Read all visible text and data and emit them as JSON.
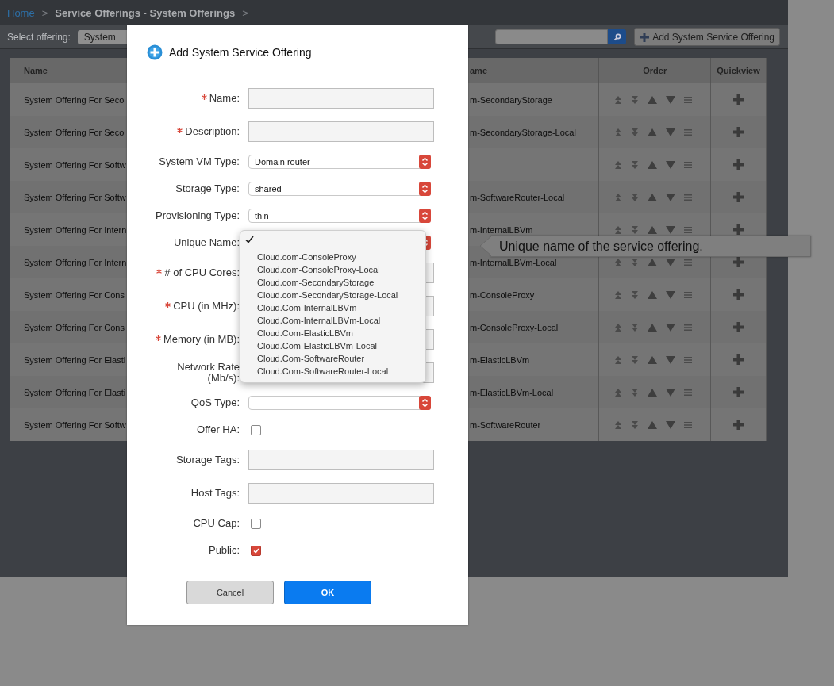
{
  "breadcrumb": {
    "items": [
      {
        "label": "Home",
        "kind": "link"
      },
      {
        "label": ">",
        "kind": "separator"
      },
      {
        "label": "Service Offerings - System Offerings",
        "kind": "current"
      },
      {
        "label": ">",
        "kind": "separator"
      }
    ]
  },
  "toolbar": {
    "filter_label": "Select offering:",
    "filter_value": "System",
    "add_button": "Add System Service Offering"
  },
  "table": {
    "columns": [
      "Name",
      "ame",
      "Order",
      "Quickview"
    ],
    "rows": [
      {
        "name": "System Offering For Seco",
        "column_3": "m-SecondaryStorage"
      },
      {
        "name": "System Offering For Seco",
        "column_3": "m-SecondaryStorage-Local"
      },
      {
        "name": "System Offering For Softw"
      },
      {
        "name": "System Offering For Softw",
        "column_3": "m-SoftwareRouter-Local"
      },
      {
        "name": "System Offering For Intern",
        "column_3": "m-InternalLBVm"
      },
      {
        "name": "System Offering For Intern",
        "column_3": "m-InternalLBVm-Local"
      },
      {
        "name": "System Offering For Cons",
        "column_3": "m-ConsoleProxy"
      },
      {
        "name": "System Offering For Cons",
        "column_3": "m-ConsoleProxy-Local"
      },
      {
        "name": "System Offering For Elasti",
        "column_3": "m-ElasticLBVm"
      },
      {
        "name": "System Offering For Elasti",
        "column_3": "m-ElasticLBVm-Local"
      },
      {
        "name": "System Offering For Softw",
        "column_3": "m-SoftwareRouter"
      }
    ]
  },
  "dialog": {
    "title": "Add System Service Offering",
    "fields": [
      {
        "label": "Name:",
        "kind": "text",
        "required": true
      },
      {
        "label": "Description:",
        "kind": "text",
        "required": true
      },
      {
        "label": "System VM Type:",
        "kind": "select",
        "required": false,
        "value": "Domain router"
      },
      {
        "label": "Storage Type:",
        "kind": "select",
        "required": false,
        "value": "shared"
      },
      {
        "label": "Provisioning Type:",
        "kind": "select",
        "required": false,
        "value": "thin"
      },
      {
        "label": "Unique Name:",
        "kind": "select",
        "required": false,
        "open": true
      },
      {
        "label": "# of CPU Cores:",
        "kind": "text",
        "required": true
      },
      {
        "label": "CPU (in MHz):",
        "kind": "text",
        "required": true
      },
      {
        "label": "Memory (in MB):",
        "kind": "text",
        "required": true
      },
      {
        "label": "Network Rate\n(Mb/s):",
        "kind": "text",
        "required": false
      },
      {
        "label": "QoS Type:",
        "kind": "select",
        "required": false
      },
      {
        "label": "Offer HA:",
        "kind": "checkbox",
        "required": false,
        "checked": false
      },
      {
        "label": "Storage Tags:",
        "kind": "text",
        "required": false
      },
      {
        "label": "Host Tags:",
        "kind": "text",
        "required": false
      },
      {
        "label": "CPU Cap:",
        "kind": "checkbox",
        "required": false,
        "checked": false
      },
      {
        "label": "Public:",
        "kind": "checkbox",
        "required": false,
        "checked": true
      }
    ],
    "dropdown": {
      "options": [
        {
          "selected": true
        },
        {
          "label": "Cloud.com-ConsoleProxy",
          "selected": false
        },
        {
          "label": "Cloud.com-ConsoleProxy-Local",
          "selected": false
        },
        {
          "label": "Cloud.com-SecondaryStorage",
          "selected": false
        },
        {
          "label": "Cloud.com-SecondaryStorage-Local",
          "selected": false
        },
        {
          "label": "Cloud.Com-InternalLBVm",
          "selected": false
        },
        {
          "label": "Cloud.Com-InternalLBVm-Local",
          "selected": false
        },
        {
          "label": "Cloud.Com-ElasticLBVm",
          "selected": false
        },
        {
          "label": "Cloud.Com-ElasticLBVm-Local",
          "selected": false
        },
        {
          "label": "Cloud.Com-SoftwareRouter",
          "selected": false
        },
        {
          "label": "Cloud.Com-SoftwareRouter-Local",
          "selected": false
        }
      ]
    },
    "tooltip": "Unique name of the service offering.",
    "buttons": [
      {
        "label": "Cancel",
        "kind": "secondary"
      },
      {
        "label": "OK",
        "kind": "primary"
      }
    ]
  }
}
